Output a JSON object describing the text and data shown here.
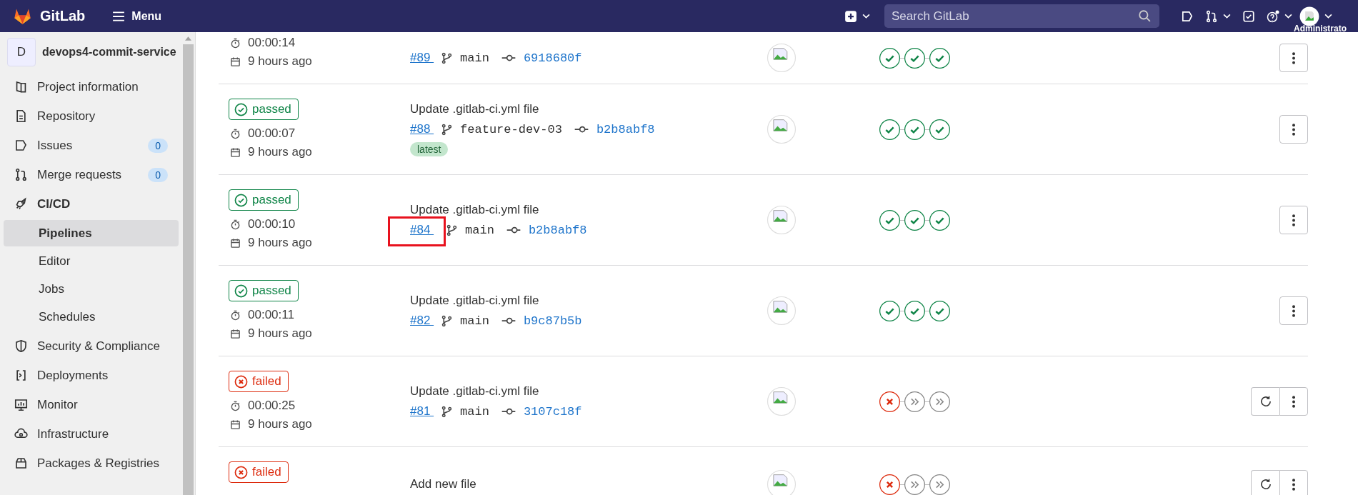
{
  "top_bar": {
    "brand": "GitLab",
    "menu": "Menu",
    "search": {
      "placeholder": "Search GitLab"
    },
    "user": "Administrato"
  },
  "sidebar": {
    "project": {
      "initial": "D",
      "name": "devops4-commit-service"
    },
    "items": [
      {
        "label": "Project information",
        "expanded": false
      },
      {
        "label": "Repository",
        "expanded": false
      },
      {
        "label": "Issues",
        "count": "0",
        "expanded": false
      },
      {
        "label": "Merge requests",
        "count": "0",
        "expanded": false
      },
      {
        "label": "CI/CD",
        "expanded": true,
        "children": [
          {
            "label": "Pipelines",
            "selected": true
          },
          {
            "label": "Editor",
            "selected": false
          },
          {
            "label": "Jobs",
            "selected": false
          },
          {
            "label": "Schedules",
            "selected": false
          }
        ]
      },
      {
        "label": "Security & Compliance",
        "expanded": false
      },
      {
        "label": "Deployments",
        "expanded": false
      },
      {
        "label": "Monitor",
        "expanded": false
      },
      {
        "label": "Infrastructure",
        "expanded": false
      },
      {
        "label": "Packages & Registries",
        "expanded": false
      }
    ]
  },
  "pipelines": [
    {
      "duration": "00:00:14",
      "finished": "9 hours ago",
      "id": "#89",
      "branch": "main",
      "commit": "6918680f",
      "stages": [
        {
          "kind": "success"
        },
        {
          "kind": "success"
        },
        {
          "kind": "success"
        }
      ],
      "retry": false
    },
    {
      "status": {
        "kind": "success",
        "label": "passed"
      },
      "duration": "00:00:07",
      "finished": "9 hours ago",
      "title": "Update .gitlab-ci.yml file",
      "id": "#88",
      "branch": "feature-dev-03",
      "commit": "b2b8abf8",
      "tag": "latest",
      "stages": [
        {
          "kind": "success"
        },
        {
          "kind": "success"
        },
        {
          "kind": "success"
        }
      ],
      "retry": false
    },
    {
      "status": {
        "kind": "success",
        "label": "passed"
      },
      "duration": "00:00:10",
      "finished": "9 hours ago",
      "title": "Update .gitlab-ci.yml file",
      "id": "#84",
      "branch": "main",
      "commit": "b2b8abf8",
      "highlighted": true,
      "stages": [
        {
          "kind": "success"
        },
        {
          "kind": "success"
        },
        {
          "kind": "success"
        }
      ],
      "retry": false
    },
    {
      "status": {
        "kind": "success",
        "label": "passed"
      },
      "duration": "00:00:11",
      "finished": "9 hours ago",
      "title": "Update .gitlab-ci.yml file",
      "id": "#82",
      "branch": "main",
      "commit": "b9c87b5b",
      "stages": [
        {
          "kind": "success"
        },
        {
          "kind": "success"
        },
        {
          "kind": "success"
        }
      ],
      "retry": false
    },
    {
      "status": {
        "kind": "failed",
        "label": "failed"
      },
      "duration": "00:00:25",
      "finished": "9 hours ago",
      "title": "Update .gitlab-ci.yml file",
      "id": "#81",
      "branch": "main",
      "commit": "3107c18f",
      "stages": [
        {
          "kind": "failed"
        },
        {
          "kind": "skipped"
        },
        {
          "kind": "skipped"
        }
      ],
      "retry": true
    },
    {
      "status": {
        "kind": "failed",
        "label": "failed"
      },
      "title": "Add new file",
      "stages": [
        {
          "kind": "failed"
        },
        {
          "kind": "skipped"
        },
        {
          "kind": "skipped"
        }
      ],
      "retry": true
    }
  ]
}
